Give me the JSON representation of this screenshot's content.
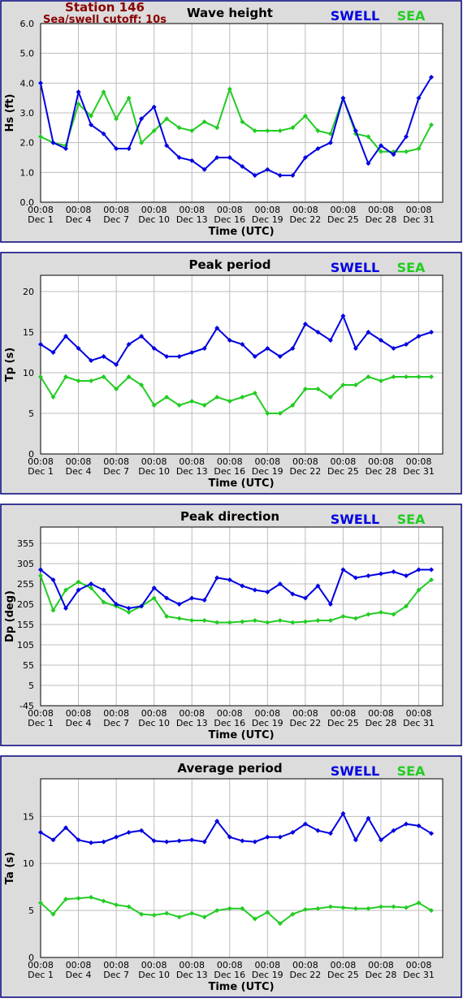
{
  "header": {
    "station": "Station 146",
    "cutoff": "Sea/swell cutoff: 10s"
  },
  "colors": {
    "swell": "#0000e0",
    "sea": "#22cc22"
  },
  "legend": {
    "swell": "SWELL",
    "sea": "SEA"
  },
  "x_axis": {
    "label": "Time (UTC)",
    "tick_times": [
      "00:08",
      "00:08",
      "00:08",
      "00:08",
      "00:08",
      "00:08",
      "00:08",
      "00:08",
      "00:08",
      "00:08",
      "00:08"
    ],
    "tick_dates": [
      "Dec 1",
      "Dec 4",
      "Dec 7",
      "Dec 10",
      "Dec 13",
      "Dec 16",
      "Dec 19",
      "Dec 22",
      "Dec 25",
      "Dec 28",
      "Dec 31"
    ]
  },
  "chart_data": [
    {
      "type": "line",
      "title": "Wave height",
      "ylabel": "Hs (ft)",
      "ylim": [
        0,
        6
      ],
      "yticks": [
        "0.0",
        "1.0",
        "2.0",
        "3.0",
        "4.0",
        "5.0",
        "6.0"
      ],
      "x": [
        0,
        1,
        2,
        3,
        4,
        5,
        6,
        7,
        8,
        9,
        10,
        11,
        12,
        13,
        14,
        15,
        16,
        17,
        18,
        19,
        20,
        21,
        22,
        23,
        24,
        25,
        26,
        27,
        28,
        29,
        30,
        31
      ],
      "series": [
        {
          "name": "SWELL",
          "values": [
            4.0,
            2.0,
            1.8,
            3.7,
            2.6,
            2.3,
            1.8,
            1.8,
            2.8,
            3.2,
            1.9,
            1.5,
            1.4,
            1.1,
            1.5,
            1.5,
            1.2,
            0.9,
            1.1,
            0.9,
            0.9,
            1.5,
            1.8,
            2.0,
            3.5,
            2.4,
            1.3,
            1.9,
            1.6,
            2.2,
            3.5,
            4.2
          ]
        },
        {
          "name": "SEA",
          "values": [
            2.2,
            2.0,
            1.9,
            3.3,
            2.9,
            3.7,
            2.8,
            3.5,
            2.0,
            2.4,
            2.8,
            2.5,
            2.4,
            2.7,
            2.5,
            3.8,
            2.7,
            2.4,
            2.4,
            2.4,
            2.5,
            2.9,
            2.4,
            2.3,
            3.5,
            2.3,
            2.2,
            1.7,
            1.7,
            1.7,
            1.8,
            2.6
          ]
        }
      ]
    },
    {
      "type": "line",
      "title": "Peak period",
      "ylabel": "Tp (s)",
      "ylim": [
        0,
        22
      ],
      "yticks": [
        "0",
        "5",
        "10",
        "15",
        "20"
      ],
      "x": [
        0,
        1,
        2,
        3,
        4,
        5,
        6,
        7,
        8,
        9,
        10,
        11,
        12,
        13,
        14,
        15,
        16,
        17,
        18,
        19,
        20,
        21,
        22,
        23,
        24,
        25,
        26,
        27,
        28,
        29,
        30,
        31
      ],
      "series": [
        {
          "name": "SWELL",
          "values": [
            13.5,
            12.5,
            14.5,
            13,
            11.5,
            12,
            11,
            13.5,
            14.5,
            13,
            12,
            12,
            12.5,
            13,
            15.5,
            14,
            13.5,
            12,
            13,
            12,
            13,
            16,
            15,
            14,
            17,
            13,
            15,
            14,
            13,
            13.5,
            14.5,
            15
          ]
        },
        {
          "name": "SEA",
          "values": [
            9.5,
            7,
            9.5,
            9,
            9,
            9.5,
            8,
            9.5,
            8.5,
            6,
            7,
            6,
            6.5,
            6,
            7,
            6.5,
            7,
            7.5,
            5,
            5,
            6,
            8,
            8,
            7,
            8.5,
            8.5,
            9.5,
            9,
            9.5,
            9.5,
            9.5,
            9.5
          ]
        }
      ]
    },
    {
      "type": "line",
      "title": "Peak direction",
      "ylabel": "Dp (deg)",
      "ylim": [
        -45,
        395
      ],
      "yticks": [
        "-45",
        "5",
        "55",
        "105",
        "155",
        "205",
        "255",
        "305",
        "355"
      ],
      "x": [
        0,
        1,
        2,
        3,
        4,
        5,
        6,
        7,
        8,
        9,
        10,
        11,
        12,
        13,
        14,
        15,
        16,
        17,
        18,
        19,
        20,
        21,
        22,
        23,
        24,
        25,
        26,
        27,
        28,
        29,
        30,
        31
      ],
      "series": [
        {
          "name": "SWELL",
          "values": [
            290,
            265,
            195,
            240,
            255,
            240,
            205,
            195,
            200,
            245,
            220,
            205,
            220,
            215,
            270,
            265,
            250,
            240,
            235,
            255,
            230,
            220,
            250,
            205,
            290,
            270,
            275,
            280,
            285,
            275,
            290,
            290
          ]
        },
        {
          "name": "SEA",
          "values": [
            275,
            190,
            240,
            260,
            245,
            210,
            200,
            185,
            200,
            220,
            175,
            170,
            165,
            165,
            160,
            160,
            162,
            165,
            160,
            165,
            160,
            162,
            165,
            165,
            175,
            170,
            180,
            185,
            180,
            200,
            240,
            265
          ]
        }
      ]
    },
    {
      "type": "line",
      "title": "Average period",
      "ylabel": "Ta (s)",
      "ylim": [
        0,
        19
      ],
      "yticks": [
        "0",
        "5",
        "10",
        "15"
      ],
      "x": [
        0,
        1,
        2,
        3,
        4,
        5,
        6,
        7,
        8,
        9,
        10,
        11,
        12,
        13,
        14,
        15,
        16,
        17,
        18,
        19,
        20,
        21,
        22,
        23,
        24,
        25,
        26,
        27,
        28,
        29,
        30,
        31
      ],
      "series": [
        {
          "name": "SWELL",
          "values": [
            13.3,
            12.5,
            13.8,
            12.5,
            12.2,
            12.3,
            12.8,
            13.3,
            13.5,
            12.4,
            12.3,
            12.4,
            12.5,
            12.3,
            14.5,
            12.8,
            12.4,
            12.3,
            12.8,
            12.8,
            13.3,
            14.2,
            13.5,
            13.2,
            15.3,
            12.5,
            14.8,
            12.5,
            13.5,
            14.2,
            14.0,
            13.2
          ]
        },
        {
          "name": "SEA",
          "values": [
            5.8,
            4.6,
            6.2,
            6.3,
            6.4,
            6.0,
            5.6,
            5.4,
            4.6,
            4.5,
            4.7,
            4.3,
            4.7,
            4.3,
            5.0,
            5.2,
            5.2,
            4.1,
            4.8,
            3.6,
            4.6,
            5.1,
            5.2,
            5.4,
            5.3,
            5.2,
            5.2,
            5.4,
            5.4,
            5.3,
            5.8,
            5.0
          ]
        }
      ]
    }
  ]
}
